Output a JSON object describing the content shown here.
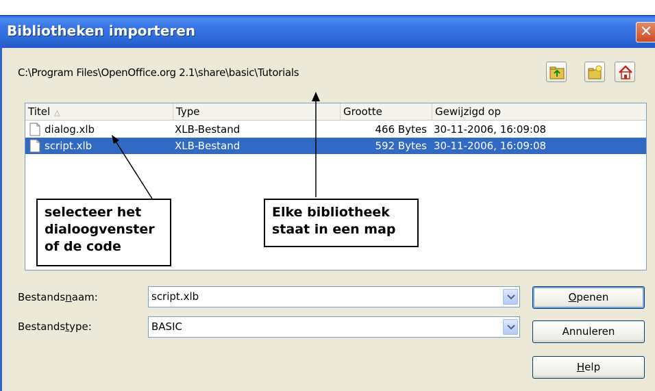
{
  "window": {
    "title": "Bibliotheken importeren",
    "close_label": "✕"
  },
  "path": "C:\\Program Files\\OpenOffice.org 2.1\\share\\basic\\Tutorials",
  "toolbar": {
    "buttons": [
      {
        "name": "up-one-level",
        "icon": "folder-up-icon"
      },
      {
        "name": "new-folder",
        "icon": "new-folder-icon"
      },
      {
        "name": "default-directory",
        "icon": "home-icon"
      }
    ]
  },
  "list": {
    "columns": [
      "Titel",
      "Type",
      "Grootte",
      "Gewijzigd op"
    ],
    "sort_indicator": "△",
    "rows": [
      {
        "name": "dialog.xlb",
        "type": "XLB-Bestand",
        "size": "466 Bytes",
        "modified": "30-11-2006, 16:09:08",
        "selected": false
      },
      {
        "name": "script.xlb",
        "type": "XLB-Bestand",
        "size": "592 Bytes",
        "modified": "30-11-2006, 16:09:08",
        "selected": true
      }
    ]
  },
  "callouts": {
    "select": "selecteer het\ndialoogvenster\nof de code",
    "library": "Elke bibliotheek\nstaat in een map"
  },
  "form": {
    "filename_label_pre": "Bestands",
    "filename_label_ul": "n",
    "filename_label_post": "aam:",
    "filename_value": "script.xlb",
    "filetype_label_pre": "Bestands",
    "filetype_label_ul": "t",
    "filetype_label_post": "ype:",
    "filetype_value": "BASIC"
  },
  "buttons": {
    "open_ul": "O",
    "open_rest": "penen",
    "cancel": "Annuleren",
    "help_ul": "H",
    "help_rest": "elp"
  },
  "colors": {
    "titlebar": "#2f6ad9",
    "selection": "#316ac5",
    "dialog_bg": "#ece9d8"
  }
}
